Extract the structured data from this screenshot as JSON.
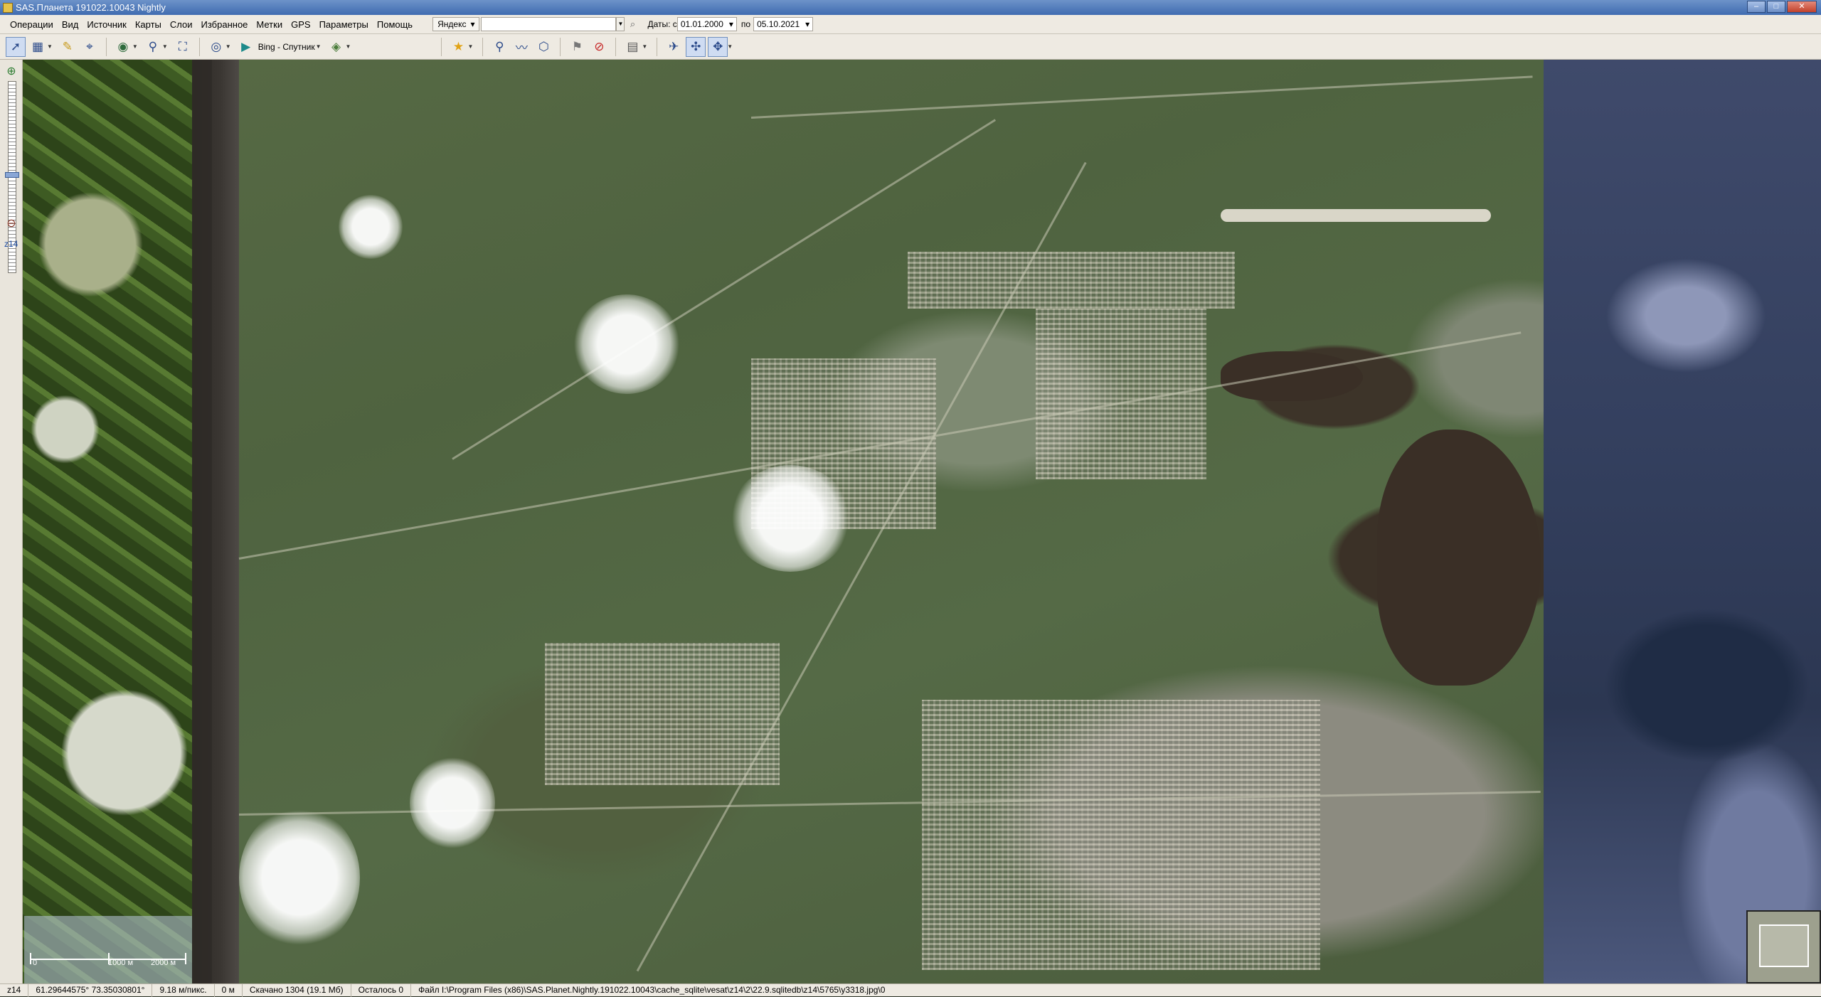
{
  "window": {
    "title": "SAS.Планета 191022.10043 Nightly"
  },
  "menu": {
    "items": [
      "Операции",
      "Вид",
      "Источник",
      "Карты",
      "Слои",
      "Избранное",
      "Метки",
      "GPS",
      "Параметры",
      "Помощь"
    ],
    "search_provider": "Яндекс",
    "search_value": "",
    "date_from_label": "Даты: с",
    "date_from": "01.01.2000",
    "date_to_label": "по",
    "date_to": "05.10.2021"
  },
  "toolbar": {
    "map_source": "Bing - Спутник"
  },
  "left_panel": {
    "zoom_level": "z14"
  },
  "scale": {
    "label_zero": "0",
    "label_mid": "1000 м",
    "label_end": "2000 м"
  },
  "status": {
    "zoom": "z14",
    "coords": "61.29644575° 73.35030801°",
    "resolution": "9.18 м/пикс.",
    "elevation": "0 м",
    "downloaded": "Скачано 1304 (19.1 Мб)",
    "remaining": "Осталось 0",
    "file": "Файл I:\\Program Files (x86)\\SAS.Planet.Nightly.191022.10043\\cache_sqlite\\vesat\\z14\\2\\22.9.sqlitedb\\z14\\5765\\y3318.jpg\\0"
  },
  "icons": [
    "cursor-icon",
    "tile-grid-icon",
    "ruler-icon",
    "compass-icon",
    "globe-icon",
    "zoom-icon",
    "fullscreen-icon",
    "gps-icon",
    "bing-icon",
    "layers-icon",
    "favorite-star-icon",
    "placemark-icon",
    "path-icon",
    "polygon-icon",
    "mark-edit-icon",
    "no-entry-icon",
    "grid-icon",
    "navigate-icon",
    "sync-icon",
    "sync2-icon"
  ]
}
